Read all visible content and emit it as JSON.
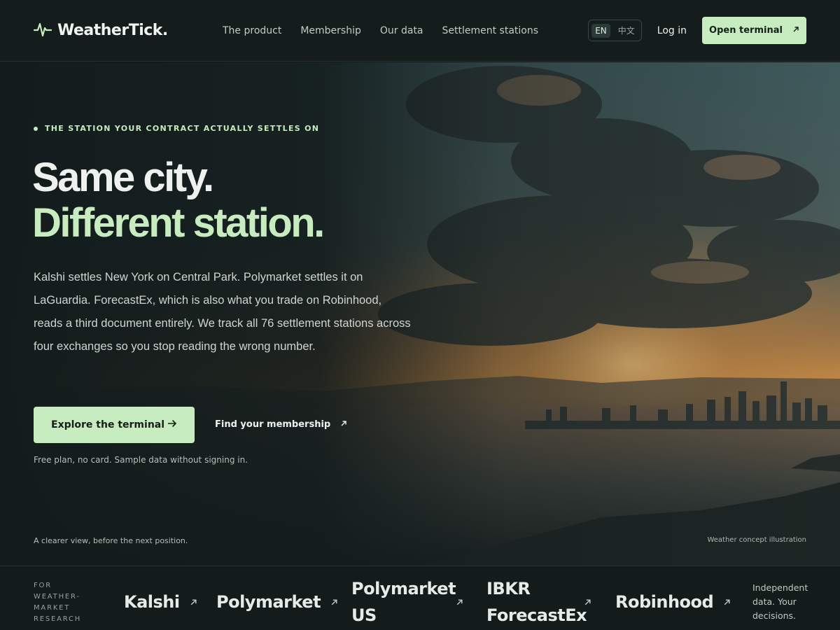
{
  "nav": {
    "brand": "WeatherTick.",
    "links": [
      "The product",
      "Membership",
      "Our data",
      "Settlement stations"
    ],
    "lang": [
      "EN",
      "中文"
    ],
    "login": "Log in",
    "cta": "Open terminal"
  },
  "hero": {
    "eyebrow": "THE STATION YOUR CONTRACT ACTUALLY SETTLES ON",
    "headline_1": "Same city.",
    "headline_2": "Different station.",
    "lede": "Kalshi settles New York on Central Park. Polymarket settles it on LaGuardia. ForecastEx, which is also what you trade on Robinhood, reads a third document entirely. We track all 76 settlement stations across four exchanges so you stop reading the wrong number.",
    "primary_cta": "Explore the terminal",
    "secondary_cta": "Find your membership",
    "note": "Free plan, no card. Sample data without signing in.",
    "caption_left": "A clearer view, before the next position.",
    "caption_right": "Weather concept illustration"
  },
  "strip": {
    "for_label": "FOR WEATHER-MARKET RESEARCH",
    "exchanges": [
      "Kalshi",
      "Polymarket",
      "Polymarket US",
      "IBKR ForecastEx",
      "Robinhood"
    ],
    "independent": "Independent data. Your decisions."
  },
  "colors": {
    "accent": "#c6ecbf",
    "background": "#141c1c"
  },
  "icons": [
    "pulse-logo-icon",
    "arrow-up-right-icon",
    "arrow-right-icon"
  ]
}
